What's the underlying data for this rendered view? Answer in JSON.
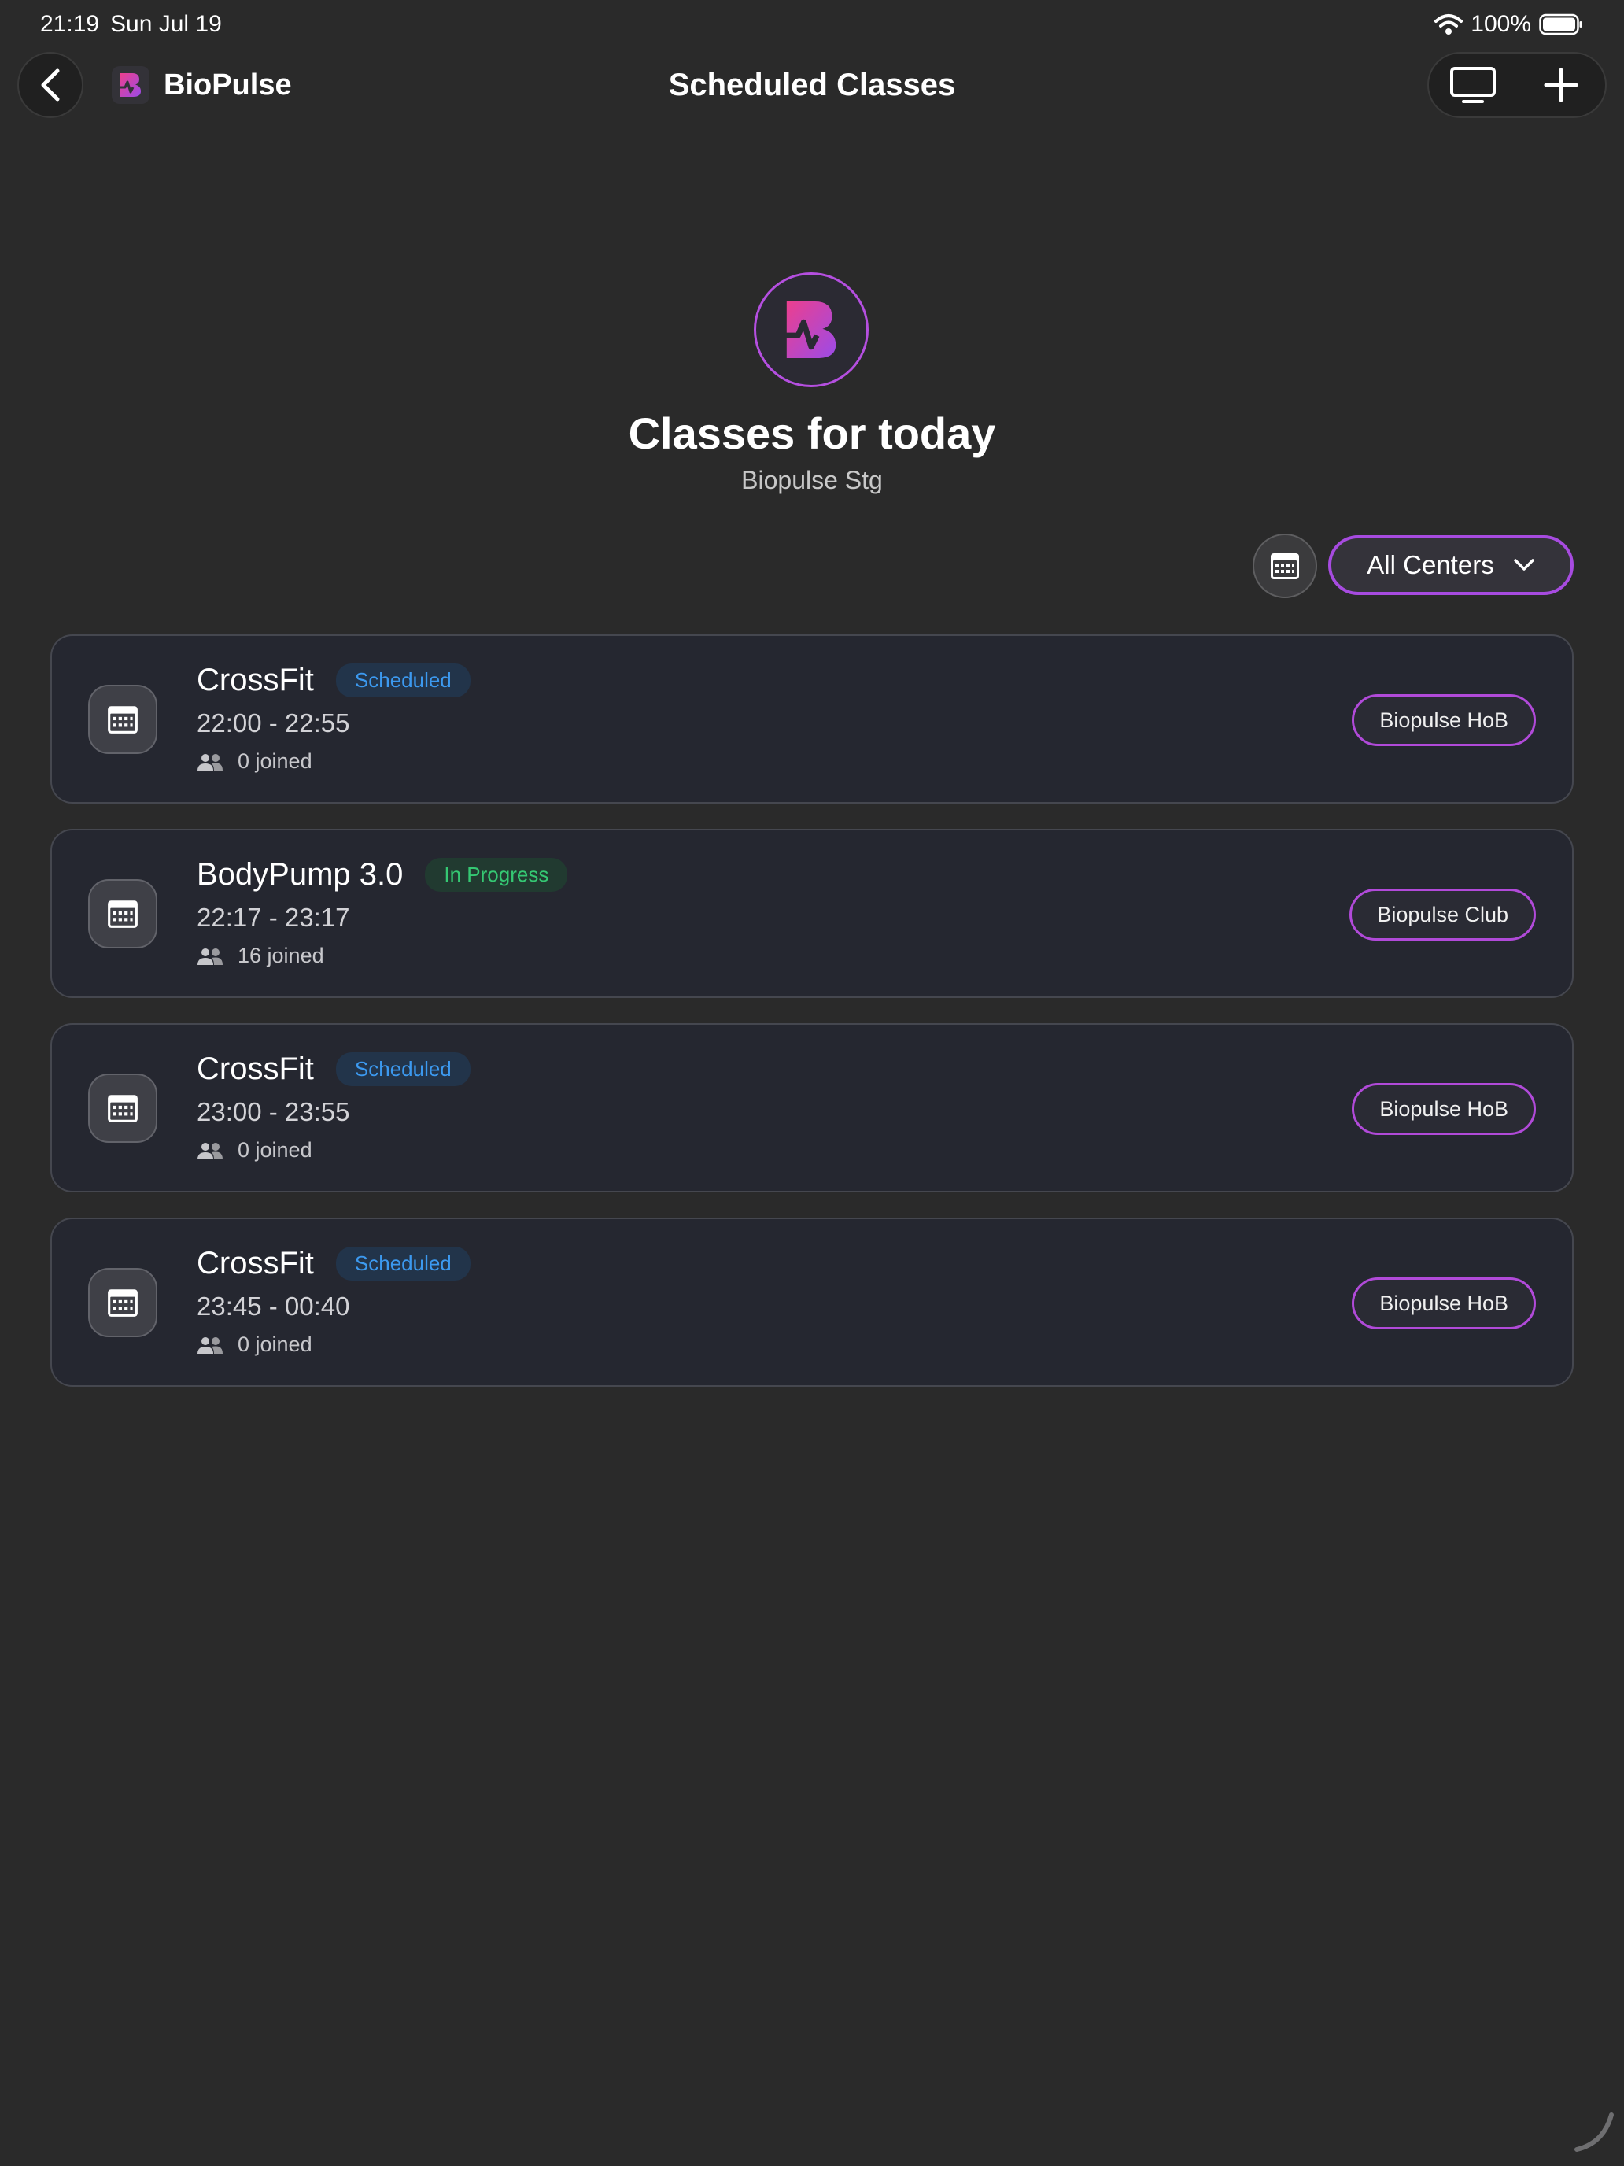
{
  "status_bar": {
    "time": "21:19",
    "date": "Sun Jul 19",
    "battery": "100%"
  },
  "nav": {
    "brand_name": "BioPulse",
    "title": "Scheduled Classes"
  },
  "header": {
    "title": "Classes for today",
    "subtitle": "Biopulse Stg"
  },
  "filters": {
    "center_select": "All Centers"
  },
  "classes": [
    {
      "name": "CrossFit",
      "status": "Scheduled",
      "status_type": "scheduled",
      "time": "22:00 - 22:55",
      "joined": "0 joined",
      "center": "Biopulse HoB"
    },
    {
      "name": "BodyPump 3.0",
      "status": "In Progress",
      "status_type": "progress",
      "time": "22:17 - 23:17",
      "joined": "16 joined",
      "center": "Biopulse Club"
    },
    {
      "name": "CrossFit",
      "status": "Scheduled",
      "status_type": "scheduled",
      "time": "23:00 - 23:55",
      "joined": "0 joined",
      "center": "Biopulse HoB"
    },
    {
      "name": "CrossFit",
      "status": "Scheduled",
      "status_type": "scheduled",
      "time": "23:45 - 00:40",
      "joined": "0 joined",
      "center": "Biopulse HoB"
    }
  ],
  "colors": {
    "background": "#2a2a2a",
    "card": "#252730",
    "accent_purple": "#a74be0",
    "accent_pink": "#ec3f8e",
    "scheduled": "#3c99ef",
    "in_progress": "#35c873"
  },
  "icons": {
    "back": "chevron-left-icon",
    "display": "monitor-icon",
    "add": "plus-icon",
    "calendar": "calendar-icon",
    "people": "people-icon",
    "chevron": "chevron-down-icon",
    "wifi": "wifi-icon",
    "battery": "battery-icon"
  }
}
